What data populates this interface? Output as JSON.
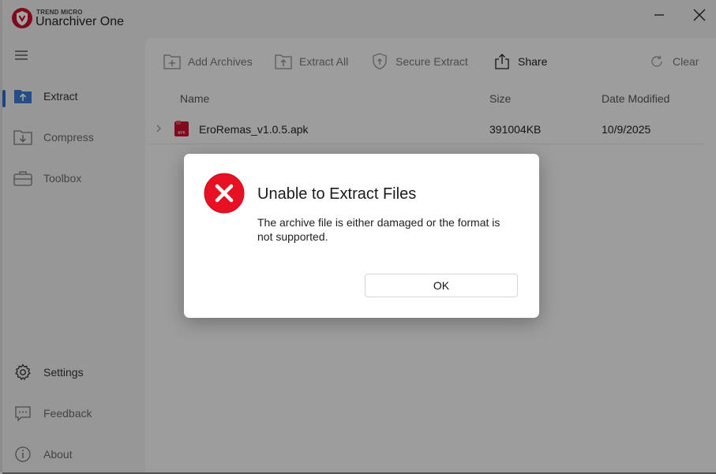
{
  "app": {
    "brand_small": "TREND MICRO",
    "title": "Unarchiver One",
    "accent": "#c8102e"
  },
  "sidebar": {
    "items": [
      {
        "label": "Extract",
        "icon": "folder-upload-icon"
      },
      {
        "label": "Compress",
        "icon": "folder-download-icon"
      },
      {
        "label": "Toolbox",
        "icon": "toolbox-icon"
      }
    ],
    "bottom": [
      {
        "label": "Settings",
        "icon": "gear-icon"
      },
      {
        "label": "Feedback",
        "icon": "feedback-icon"
      },
      {
        "label": "About",
        "icon": "info-icon"
      }
    ]
  },
  "toolbar": {
    "add_archives": "Add Archives",
    "extract_all": "Extract All",
    "secure_extract": "Secure Extract",
    "share": "Share",
    "clear": "Clear"
  },
  "table": {
    "columns": [
      "Name",
      "Size",
      "Date Modified"
    ],
    "rows": [
      {
        "name": "EroRemas_v1.0.5.apk",
        "size": "391004KB",
        "date": "10/9/2025",
        "file_badge": "APK"
      }
    ]
  },
  "dialog": {
    "title": "Unable to Extract Files",
    "message": "The archive file is either damaged or the format is not supported.",
    "ok_label": "OK",
    "error_color": "#e81123"
  }
}
